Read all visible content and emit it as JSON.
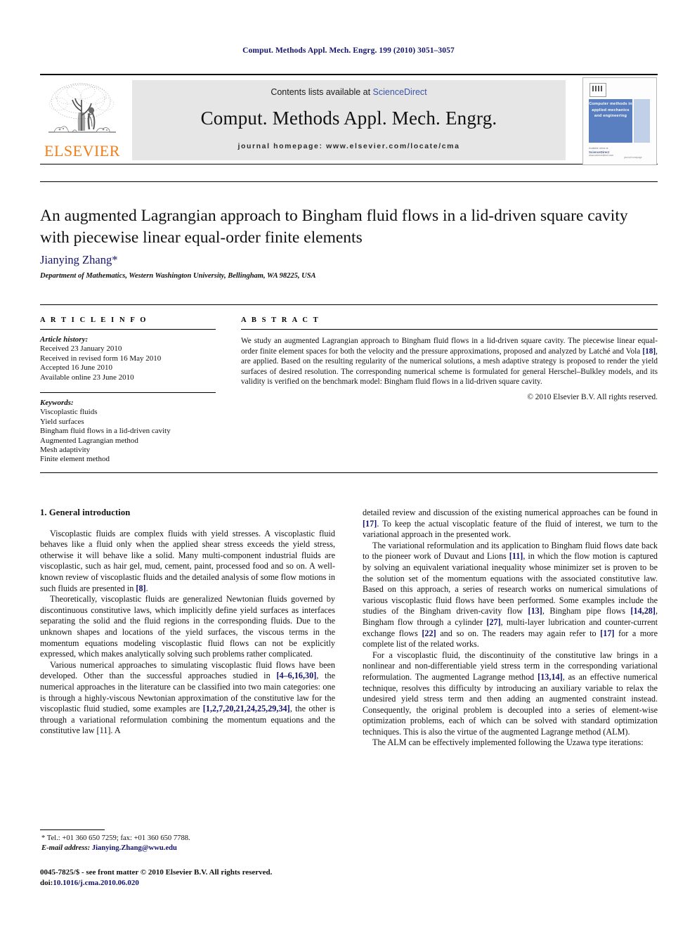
{
  "running_head": "Comput. Methods Appl. Mech. Engrg. 199 (2010) 3051–3057",
  "masthead": {
    "publisher_name": "ELSEVIER",
    "contents_prefix": "Contents lists available at ",
    "contents_link": "ScienceDirect",
    "journal_title": "Comput. Methods Appl. Mech. Engrg.",
    "homepage": "journal homepage: www.elsevier.com/locate/cma",
    "cover": {
      "title_lines": "Computer methods in applied mechanics and engineering",
      "available_at": "Available online at",
      "sciencedirect": "ScienceDirect",
      "url": "www.sciencedirect.com",
      "right_note": "journal homepage"
    }
  },
  "article": {
    "title": "An augmented Lagrangian approach to Bingham fluid flows in a lid-driven square cavity with piecewise linear equal-order finite elements",
    "author": "Jianying Zhang*",
    "affiliation": "Department of Mathematics, Western Washington University, Bellingham, WA 98225, USA"
  },
  "article_info": {
    "heading": "A R T I C L E   I N F O",
    "history_label": "Article history:",
    "history": [
      "Received 23 January 2010",
      "Received in revised form 16 May 2010",
      "Accepted 16 June 2010",
      "Available online 23 June 2010"
    ],
    "keywords_label": "Keywords:",
    "keywords": [
      "Viscoplastic fluids",
      "Yield surfaces",
      "Bingham fluid flows in a lid-driven cavity",
      "Augmented Lagrangian method",
      "Mesh adaptivity",
      "Finite element method"
    ]
  },
  "abstract": {
    "heading": "A B S T R A C T",
    "part1": "We study an augmented Lagrangian approach to Bingham fluid flows in a lid-driven square cavity. The piecewise linear equal-order finite element spaces for both the velocity and the pressure approximations, proposed and analyzed by Latché and Vola ",
    "ref1": "[18]",
    "part2": ", are applied. Based on the resulting regularity of the numerical solutions, a mesh adaptive strategy is proposed to render the yield surfaces of desired resolution. The corresponding numerical scheme is formulated for general Herschel–Bulkley models, and its validity is verified on the benchmark model: Bingham fluid flows in a lid-driven square cavity.",
    "copyright": "© 2010 Elsevier B.V. All rights reserved."
  },
  "section1": {
    "heading": "1. General introduction",
    "p1_a": "Viscoplastic fluids are complex fluids with yield stresses. A viscoplastic fluid behaves like a fluid only when the applied shear stress exceeds the yield stress, otherwise it will behave like a solid. Many multi-component industrial fluids are viscoplastic, such as hair gel, mud, cement, paint, processed food and so on. A well-known review of viscoplastic fluids and the detailed analysis of some flow motions in such fluids are presented in ",
    "p1_ref": "[8]",
    "p1_b": ".",
    "p2": "Theoretically, viscoplastic fluids are generalized Newtonian fluids governed by discontinuous constitutive laws, which implicitly define yield surfaces as interfaces separating the solid and the fluid regions in the corresponding fluids. Due to the unknown shapes and locations of the yield surfaces, the viscous terms in the momentum equations modeling viscoplastic fluid flows can not be explicitly expressed, which makes analytically solving such problems rather complicated.",
    "p3_a": "Various numerical approaches to simulating viscoplastic fluid flows have been developed. Other than the successful approaches studied in ",
    "p3_ref1": "[4–6,16,30]",
    "p3_b": ", the numerical approaches in the literature can be classified into two main categories: one is through a highly-viscous Newtonian approximation of the constitutive law for the viscoplastic fluid studied, some examples are ",
    "p3_ref2": "[1,2,7,20,21,24,25,29,34]",
    "p3_c": ", the other is through a variational reformulation combining the momentum equations and the constitutive law [11]. A",
    "r1_a": "detailed review and discussion of the existing numerical approaches can be found in ",
    "r1_ref": "[17]",
    "r1_b": ". To keep the actual viscoplatic feature of the fluid of interest, we turn to the variational approach in the presented work.",
    "r2_a": "The variational reformulation and its application to Bingham fluid flows date back to the pioneer work of Duvaut and Lions ",
    "r2_ref1": "[11]",
    "r2_b": ", in which the flow motion is captured by solving an equivalent variational inequality whose minimizer set is proven to be the solution set of the momentum equations with the associated constitutive law. Based on this approach, a series of research works on numerical simulations of various viscoplastic fluid flows have been performed. Some examples include the studies of the Bingham driven-cavity flow ",
    "r2_ref2": "[13]",
    "r2_c": ", Bingham pipe flows ",
    "r2_ref3": "[14,28]",
    "r2_d": ", Bingham flow through a cylinder ",
    "r2_ref4": "[27]",
    "r2_e": ", multi-layer lubrication and counter-current exchange flows ",
    "r2_ref5": "[22]",
    "r2_f": " and so on. The readers may again refer to ",
    "r2_ref6": "[17]",
    "r2_g": " for a more complete list of the related works.",
    "r3_a": "For a viscoplastic fluid, the discontinuity of the constitutive law brings in a nonlinear and non-differentiable yield stress term in the corresponding variational reformulation. The augmented Lagrange method ",
    "r3_ref": "[13,14]",
    "r3_b": ", as an effective numerical technique, resolves this difficulty by introducing an auxiliary variable to relax the undesired yield stress term and then adding an augmented constraint instead. Consequently, the original problem is decoupled into a series of element-wise optimization problems, each of which can be solved with standard optimization techniques. This is also the virtue of the augmented Lagrange method (ALM).",
    "r4": "The ALM can be effectively implemented following the Uzawa type iterations:"
  },
  "footnote": {
    "tel_line": "* Tel.: +01 360 650 7259; fax: +01 360 650 7788.",
    "email_label": "E-mail address:",
    "email": "Jianying.Zhang@wwu.edu"
  },
  "footer": {
    "line1": "0045-7825/$ - see front matter © 2010 Elsevier B.V. All rights reserved.",
    "doi_label": "doi:",
    "doi": "10.1016/j.cma.2010.06.020"
  },
  "colors": {
    "link_blue": "#14146e",
    "sciencedirect_blue": "#3a55a5",
    "elsevier_orange": "#F07D18",
    "band_gray": "#e6e6e6"
  }
}
